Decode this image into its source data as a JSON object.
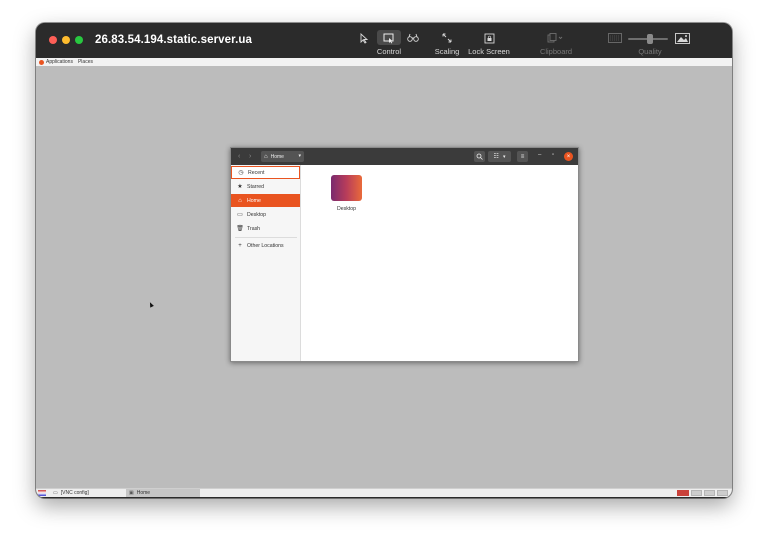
{
  "window": {
    "title": "26.83.54.194.static.server.ua"
  },
  "toolbar": {
    "control_label": "Control",
    "scaling_label": "Scaling",
    "lock_screen_label": "Lock Screen",
    "clipboard_label": "Clipboard",
    "quality_label": "Quality",
    "quality_level_fraction": 0.55
  },
  "remote_top_panel": {
    "applications_label": "Applications",
    "places_label": "Places"
  },
  "files_window": {
    "path_label": "Home",
    "sidebar": [
      {
        "label": "Recent",
        "icon": "clock-icon"
      },
      {
        "label": "Starred",
        "icon": "star-icon"
      },
      {
        "label": "Home",
        "icon": "home-icon"
      },
      {
        "label": "Desktop",
        "icon": "desktop-icon"
      },
      {
        "label": "Trash",
        "icon": "trash-icon"
      },
      {
        "label": "Other Locations",
        "icon": "plus-icon"
      }
    ],
    "items": [
      {
        "label": "Desktop"
      }
    ]
  },
  "taskbar": {
    "task1": "[VNC config]",
    "task2": "Home"
  },
  "colors": {
    "accent": "#e95420",
    "mac_titlebar": "#2b2b2b",
    "remote_background": "#bcbcbc"
  }
}
